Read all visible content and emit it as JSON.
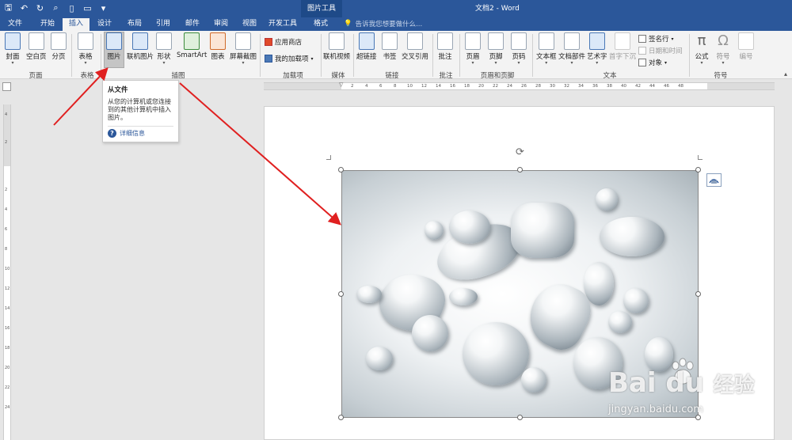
{
  "app": {
    "contextual_tab_group": "图片工具",
    "window_title": "文档2 - Word",
    "accent_color": "#2b579a"
  },
  "tabs": [
    {
      "label": "文件"
    },
    {
      "label": "开始"
    },
    {
      "label": "插入",
      "active": true
    },
    {
      "label": "设计"
    },
    {
      "label": "布局"
    },
    {
      "label": "引用"
    },
    {
      "label": "邮件"
    },
    {
      "label": "审阅"
    },
    {
      "label": "视图"
    },
    {
      "label": "开发工具"
    },
    {
      "label": "格式"
    }
  ],
  "tell_me": {
    "placeholder": "告诉我您想要做什么..."
  },
  "ribbon": {
    "pages": {
      "cover": "封面",
      "blank": "空白页",
      "break": "分页",
      "group": "页面"
    },
    "tables": {
      "table": "表格",
      "group": "表格"
    },
    "illustrations": {
      "picture": "图片",
      "online_picture": "联机图片",
      "shapes": "形状",
      "smartart": "SmartArt",
      "chart": "图表",
      "screenshot": "屏幕截图",
      "group": "插图"
    },
    "addins": {
      "store": "应用商店",
      "my_addins": "我的加载项",
      "group": "加载项"
    },
    "media": {
      "online_video": "联机视频",
      "group": "媒体"
    },
    "links": {
      "hyperlink": "超链接",
      "bookmark": "书签",
      "cross_ref": "交叉引用",
      "group": "链接"
    },
    "comments": {
      "comment": "批注",
      "group": "批注"
    },
    "header_footer": {
      "header": "页眉",
      "footer": "页脚",
      "page_number": "页码",
      "group": "页眉和页脚"
    },
    "text": {
      "textbox": "文本框",
      "quick_parts": "文档部件",
      "wordart": "艺术字",
      "dropcap": "首字下沉",
      "signature": "签名行",
      "datetime": "日期和时间",
      "object": "对象",
      "group": "文本"
    },
    "symbols": {
      "equation": "公式",
      "symbol": "符号",
      "numbering": "编号",
      "group": "符号"
    }
  },
  "tooltip": {
    "title": "从文件",
    "description": "从您的计算机或您连接到的其他计算机中插入图片。",
    "more_info": "详细信息"
  },
  "ruler_h": [
    "2",
    "4",
    "6",
    "8",
    "10",
    "12",
    "14",
    "16",
    "18",
    "20",
    "22",
    "24",
    "26",
    "28",
    "30",
    "32",
    "34",
    "36",
    "38",
    "40",
    "42",
    "44",
    "46",
    "48"
  ],
  "ruler_v": [
    "4",
    "2",
    "2",
    "4",
    "6",
    "8",
    "10",
    "12",
    "14",
    "16",
    "18",
    "20",
    "22",
    "24"
  ],
  "watermark": {
    "brand_text": "Bai du",
    "brand_cn": "经验",
    "url": "jingyan.baidu.com"
  }
}
